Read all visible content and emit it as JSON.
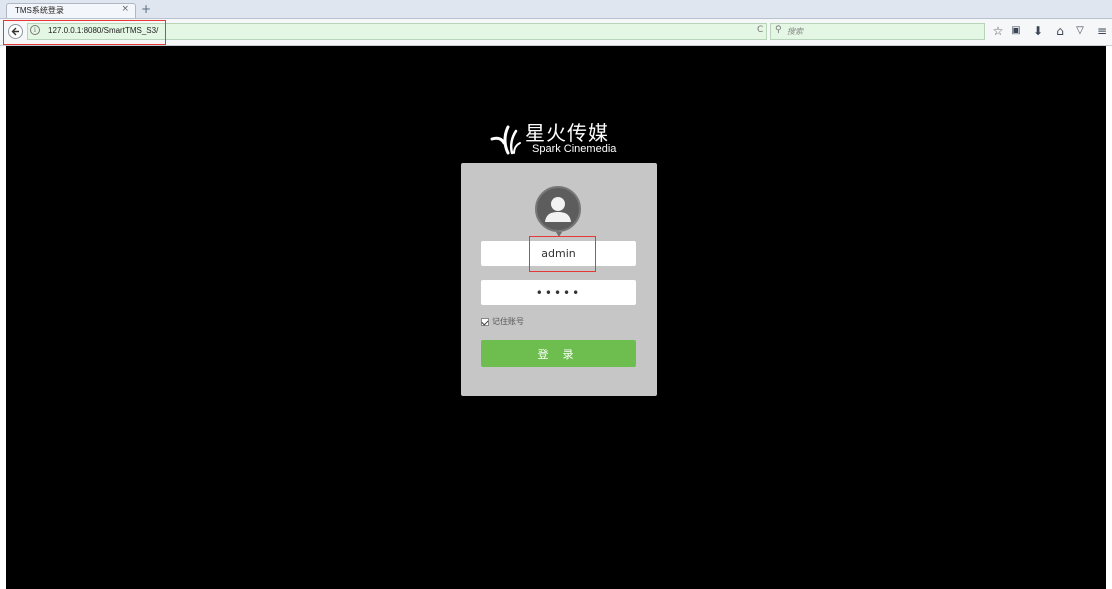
{
  "browser": {
    "tab_title": "TMS系统登录",
    "tab_close": "×",
    "new_tab": "+",
    "url": "127.0.0.1:8080/SmartTMS_S3/",
    "reload": "C",
    "search_placeholder": "搜索",
    "toolbar_icons": [
      "bookmark-star-icon",
      "reading-list-icon",
      "download-icon",
      "home-icon",
      "pocket-icon",
      "menu-icon"
    ],
    "urlbar_color": "#e4f7e4"
  },
  "brand": {
    "name_cn": "星火传媒",
    "name_en": "Spark Cinemedia"
  },
  "login": {
    "username": "admin",
    "password_mask": "•••••",
    "remember_label": "记住账号",
    "remember_checked": true,
    "submit_label": "登录",
    "button_color": "#6ebd4f",
    "panel_color": "#c6c6c6"
  }
}
